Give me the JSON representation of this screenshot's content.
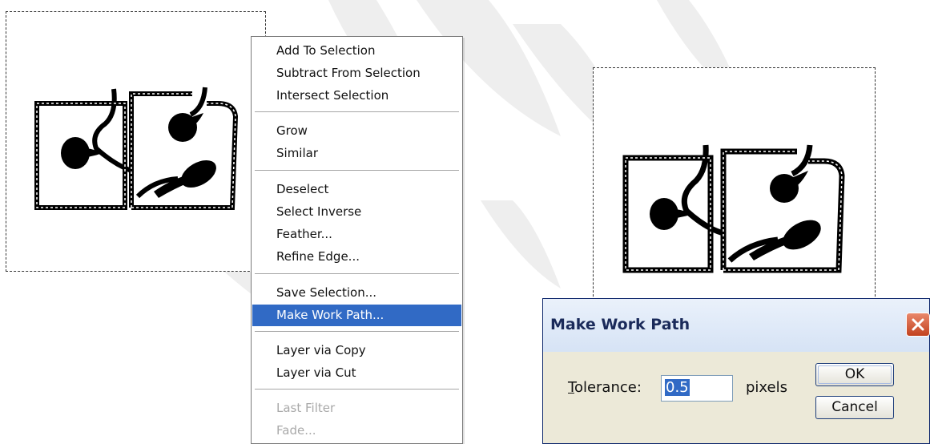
{
  "context_menu": {
    "items": [
      {
        "label": "Add To Selection",
        "state": "normal"
      },
      {
        "label": "Subtract From Selection",
        "state": "normal"
      },
      {
        "label": "Intersect Selection",
        "state": "normal"
      },
      {
        "label": "Grow",
        "state": "normal"
      },
      {
        "label": "Similar",
        "state": "normal"
      },
      {
        "label": "Deselect",
        "state": "normal"
      },
      {
        "label": "Select Inverse",
        "state": "normal"
      },
      {
        "label": "Feather...",
        "state": "normal"
      },
      {
        "label": "Refine Edge...",
        "state": "normal"
      },
      {
        "label": "Save Selection...",
        "state": "normal"
      },
      {
        "label": "Make Work Path...",
        "state": "selected"
      },
      {
        "label": "Layer via Copy",
        "state": "normal"
      },
      {
        "label": "Layer via Cut",
        "state": "normal"
      },
      {
        "label": "Last Filter",
        "state": "disabled"
      },
      {
        "label": "Fade...",
        "state": "disabled"
      }
    ]
  },
  "dialog": {
    "title": "Make Work Path",
    "tolerance_label_mnemonic": "T",
    "tolerance_label_rest": "olerance:",
    "tolerance_value": "0.5",
    "unit_label": "pixels",
    "ok_label": "OK",
    "cancel_label": "Cancel"
  },
  "colors": {
    "menu_highlight": "#316ac5",
    "dialog_face": "#ece9d8",
    "close_button": "#c2421f"
  },
  "icons": {
    "close": "close-x-icon",
    "artwork": "leaf-vine-shape"
  }
}
